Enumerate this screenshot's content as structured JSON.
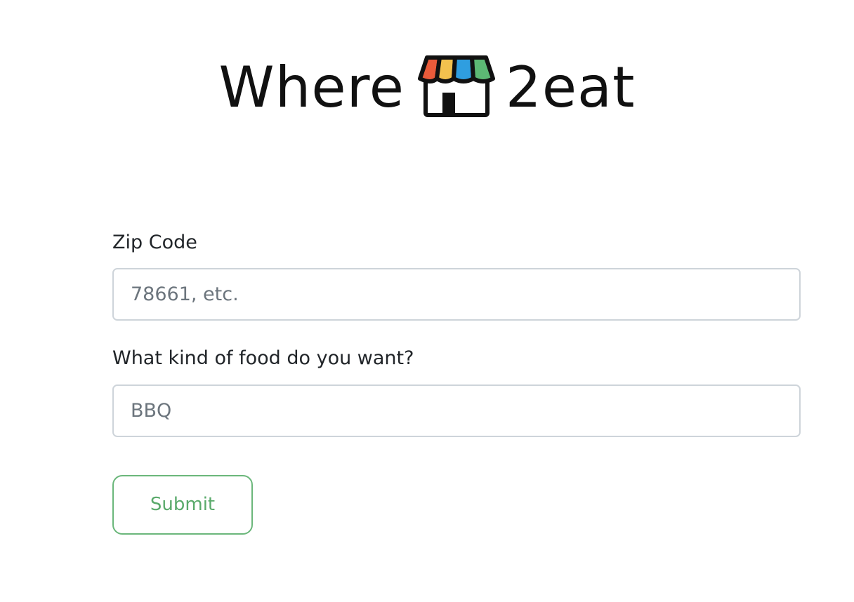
{
  "brand": {
    "word_left": "Where",
    "word_right": "2eat",
    "icon": "storefront-icon",
    "awning_colors": [
      "#ea5b3a",
      "#f2c14e",
      "#2f9ee0",
      "#5cb874"
    ]
  },
  "form": {
    "zip": {
      "label": "Zip Code",
      "placeholder": "78661, etc.",
      "value": ""
    },
    "food": {
      "label": "What kind of food do you want?",
      "placeholder": "BBQ",
      "value": ""
    },
    "submit_label": "Submit"
  },
  "colors": {
    "submit_accent": "#6bb77b",
    "input_border": "#ced4da"
  }
}
